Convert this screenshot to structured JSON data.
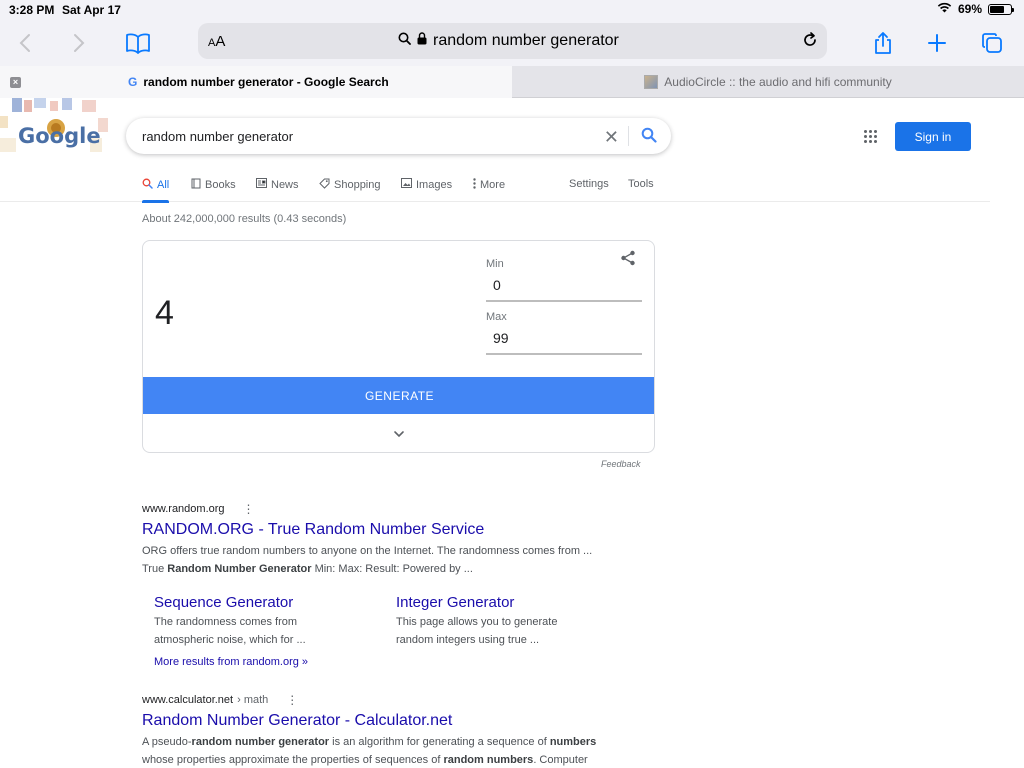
{
  "status_bar": {
    "time": "3:28 PM",
    "date": "Sat Apr 17",
    "battery_text": "69%",
    "battery_level": 0.69
  },
  "toolbar": {
    "text_size_label_small": "A",
    "text_size_label_large": "A",
    "url_text": "random number generator"
  },
  "tabs": [
    {
      "title": "random number generator - Google Search",
      "active": true
    },
    {
      "title": "AudioCircle :: the audio and hifi community",
      "active": false
    }
  ],
  "google": {
    "logo_text": "Google",
    "search_query": "random number generator",
    "sign_in_label": "Sign in",
    "nav_tabs": [
      {
        "label": "All",
        "icon": "search-icon"
      },
      {
        "label": "Books",
        "icon": "book-icon"
      },
      {
        "label": "News",
        "icon": "news-icon"
      },
      {
        "label": "Shopping",
        "icon": "tag-icon"
      },
      {
        "label": "Images",
        "icon": "image-icon"
      },
      {
        "label": "More",
        "icon": "more-vert-icon"
      }
    ],
    "settings_label": "Settings",
    "tools_label": "Tools",
    "result_stats": "About 242,000,000 results (0.43 seconds)"
  },
  "rng_widget": {
    "result": "4",
    "min_label": "Min",
    "min_value": "0",
    "max_label": "Max",
    "max_value": "99",
    "generate_label": "GENERATE",
    "feedback_label": "Feedback"
  },
  "results": [
    {
      "cite": "www.random.org",
      "title": "RANDOM.ORG - True Random Number Service",
      "snippet_line1": "ORG offers true random numbers to anyone on the Internet. The randomness comes from ...",
      "snippet_line2_pre": "True ",
      "snippet_line2_bold": "Random Number Generator",
      "snippet_line2_post": " Min: Max: Result: Powered by ...",
      "sitelinks": [
        {
          "title": "Sequence Generator",
          "desc1": "The randomness comes from",
          "desc2": "atmospheric noise, which for ..."
        },
        {
          "title": "Integer Generator",
          "desc1": "This page allows you to generate",
          "desc2": "random integers using true ..."
        }
      ],
      "more_results": "More results from random.org »"
    },
    {
      "cite": "www.calculator.net",
      "cite_crumb": "› math",
      "title": "Random Number Generator - Calculator.net",
      "snippet_parts": [
        {
          "t": "A pseudo-",
          "b": false
        },
        {
          "t": "random number generator",
          "b": true
        },
        {
          "t": " is an algorithm for generating a sequence of ",
          "b": false
        },
        {
          "t": "numbers",
          "b": true
        },
        {
          "t": " whose properties approximate the properties of sequences of ",
          "b": false
        },
        {
          "t": "random numbers",
          "b": true
        },
        {
          "t": ". Computer",
          "b": false
        }
      ]
    }
  ],
  "colors": {
    "google_blue": "#4285f4",
    "link_blue": "#1a0dab",
    "safari_blue": "#0a7aff"
  }
}
